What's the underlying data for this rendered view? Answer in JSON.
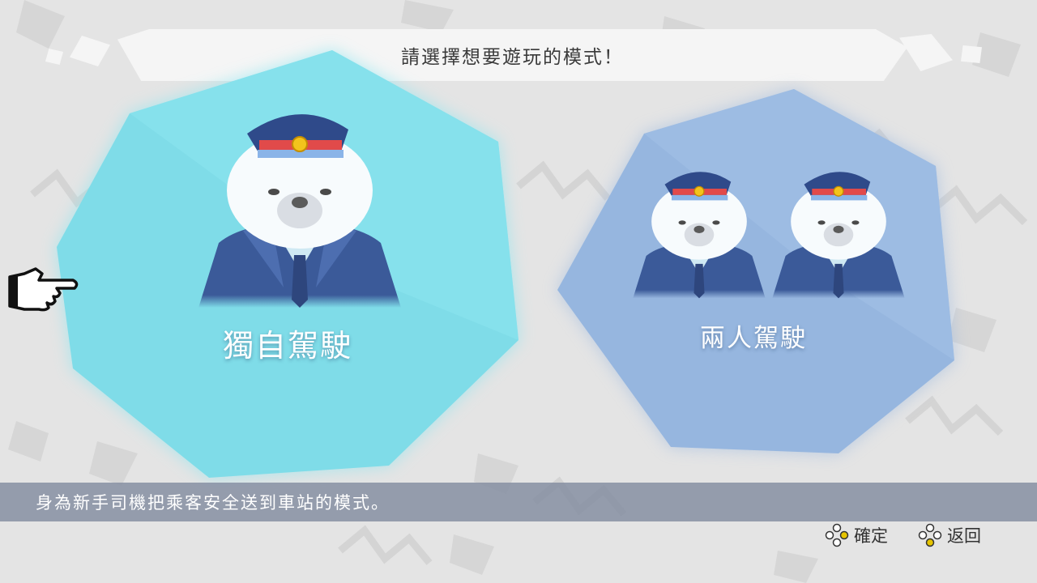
{
  "header": {
    "title": "請選擇想要遊玩的模式！"
  },
  "modes": [
    {
      "label": "獨自駕駛",
      "selected": true,
      "color": "#7fdce8"
    },
    {
      "label": "兩人駕駛",
      "selected": false,
      "color": "#96b6df"
    }
  ],
  "description": "身為新手司機把乘客安全送到車站的模式。",
  "prompts": {
    "confirm": {
      "label": "確定",
      "icon": "controller-buttons-icon"
    },
    "back": {
      "label": "返回",
      "icon": "controller-buttons-icon"
    }
  },
  "colors": {
    "background": "#e4e4e4",
    "selected_panel": "#7fdce8",
    "unselected_panel": "#96b6df",
    "uniform": "#3b5a99",
    "hat_band": "#e14a4a"
  }
}
